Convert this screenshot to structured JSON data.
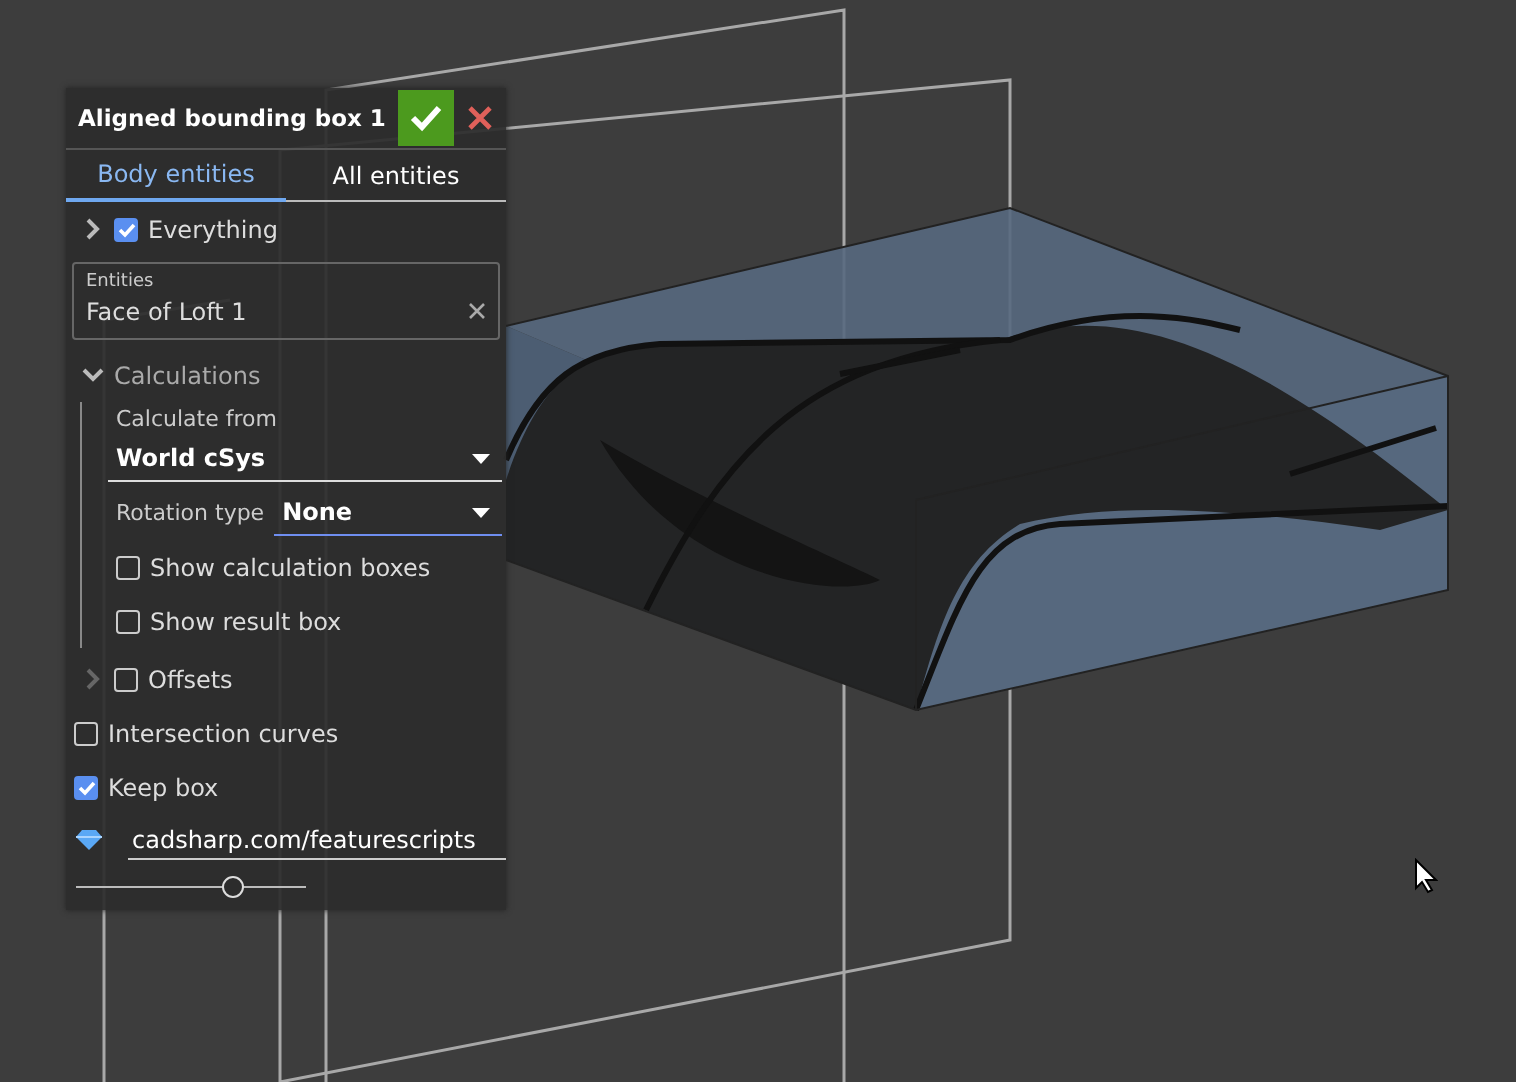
{
  "panel": {
    "title": "Aligned bounding box 1",
    "tabs": [
      {
        "label": "Body entities",
        "selected": true
      },
      {
        "label": "All entities",
        "selected": false
      }
    ],
    "items": [
      {
        "kind": "checkbox",
        "label": "Everything",
        "checked": true,
        "expanded": false
      },
      {
        "kind": "field",
        "label": "Entities",
        "value": "Face of Loft 1"
      },
      {
        "kind": "section",
        "label": "Calculations",
        "expanded": true,
        "children": [
          {
            "kind": "dropdown",
            "label": "Calculate from",
            "value": "World cSys"
          },
          {
            "kind": "picker",
            "label": "Rotation type",
            "value": "None"
          },
          {
            "kind": "checkbox",
            "label": "Show calculation boxes",
            "checked": false
          },
          {
            "kind": "checkbox",
            "label": "Show result box",
            "checked": false
          }
        ]
      },
      {
        "kind": "checkbox",
        "label": "Offsets",
        "checked": false,
        "expanded": false
      },
      {
        "kind": "checkbox",
        "label": "Intersection curves",
        "checked": false
      },
      {
        "kind": "checkbox",
        "label": "Keep box",
        "checked": true
      },
      {
        "kind": "link",
        "value": "cadsharp.com/featurescripts"
      },
      {
        "kind": "slider",
        "level": 0.68
      }
    ]
  }
}
